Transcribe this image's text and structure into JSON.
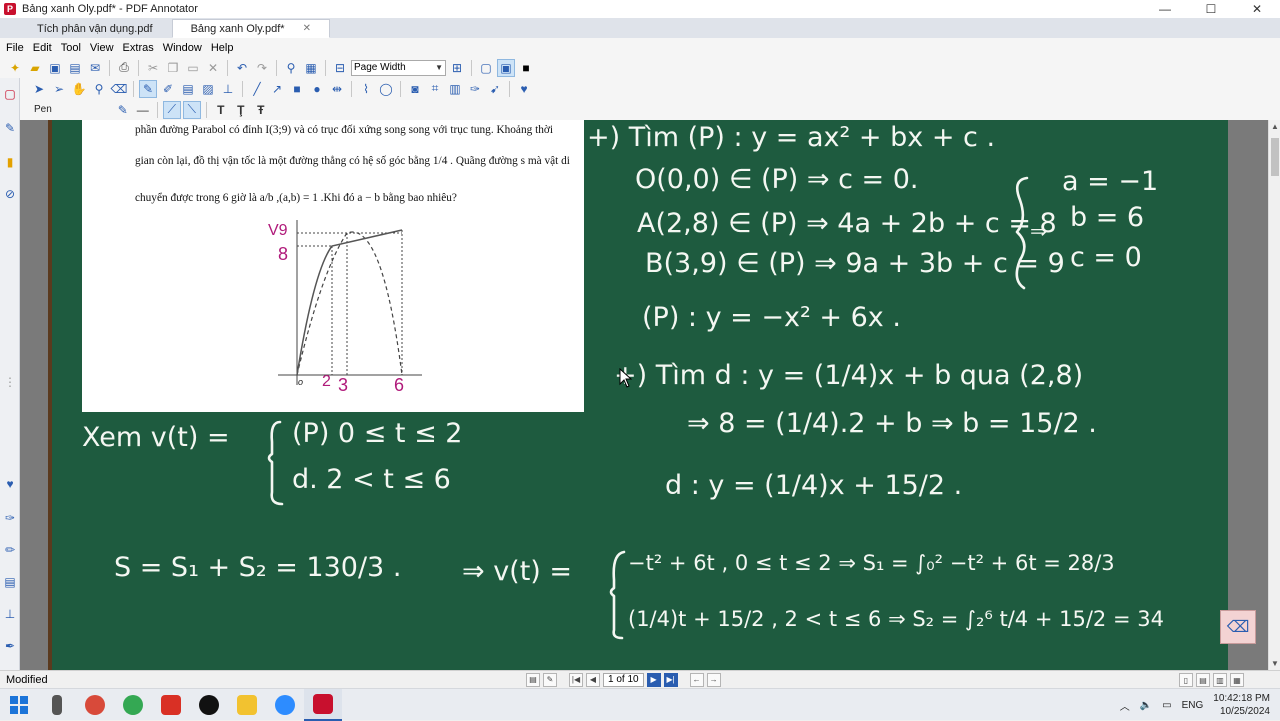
{
  "window": {
    "title": "Bảng xanh Oly.pdf* - PDF Annotator",
    "icon": "pdf-annotator-icon"
  },
  "tabs": [
    {
      "label": "Tích phân vận dụng.pdf"
    },
    {
      "label": "Bảng xanh Oly.pdf*"
    }
  ],
  "menu": [
    "File",
    "Edit",
    "Tool",
    "View",
    "Extras",
    "Window",
    "Help"
  ],
  "toolbar": {
    "zoom_mode": "Page Width",
    "pen_label": "Pen"
  },
  "document": {
    "problem_lines": [
      "phần đường Parabol có đỉnh  I(3;9) và có trục đối xứng song song với trục tung. Khoảng thời",
      "gian còn lại, đồ thị vận tốc là một đường thẳng có hệ số góc bằng  1/4 . Quãng đường  s  mà vật di",
      "chuyển được trong 6 giờ là  a/b  ,(a,b) = 1 .Khi đó  a − b  bằng bao nhiêu?"
    ],
    "graph_ticks": {
      "origin": "o",
      "x_marks": [
        "2",
        "3",
        "6"
      ],
      "y_marks": [
        "V9",
        "8"
      ]
    },
    "board": {
      "parabola": [
        "+) Tìm (P) :  y = ax² + bx + c .",
        "O(0,0) ∈ (P) ⇒  c = 0.",
        "A(2,8) ∈ (P) ⇒ 4a + 2b + c = 8",
        "B(3,9) ∈ (P) ⇒ 9a + 3b + c = 9",
        "a = −1",
        "b = 6",
        "c = 0",
        "(P) : y = −x² + 6x ."
      ],
      "line_d": [
        "+) Tìm d :  y = (1/4)x + b    qua (2,8)",
        "⇒ 8 = (1/4).2 + b ⇒ b = 15/2 .",
        "d :  y = (1/4)x + 15/2 ."
      ],
      "velocity": [
        "Xem  v(t) =",
        "(P)   0 ≤ t ≤ 2",
        "d.    2 < t ≤ 6"
      ],
      "area": [
        "S = S₁ + S₂ = 130/3 .",
        "⇒ v(t) =",
        "−t² + 6t ,  0 ≤ t ≤ 2 ⇒ S₁ = ∫₀² −t² + 6t = 28/3",
        "(1/4)t + 15/2 ,  2 < t ≤ 6 ⇒ S₂ = ∫₂⁶ t/4 + 15/2 = 34"
      ]
    }
  },
  "status": {
    "text": "Modified",
    "page_indicator": "1 of 10"
  },
  "taskbar": {
    "language": "ENG",
    "time": "10:42:18 PM",
    "date": "10/25/2024"
  }
}
